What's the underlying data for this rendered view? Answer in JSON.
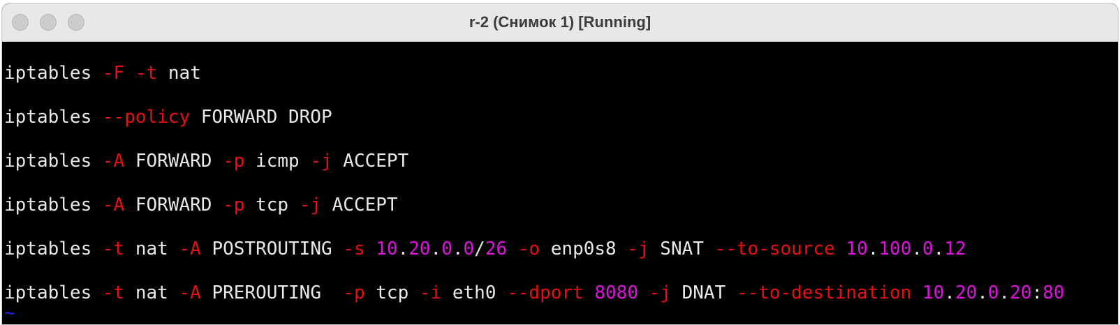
{
  "window": {
    "title": "r-2 (Снимок 1) [Running]"
  },
  "terminal": {
    "lines": [
      {
        "tokens": [
          {
            "text": "iptables ",
            "color": "white"
          },
          {
            "text": "-F -t",
            "color": "red"
          },
          {
            "text": " nat",
            "color": "white"
          }
        ]
      },
      {
        "tokens": [
          {
            "text": "iptables ",
            "color": "white"
          },
          {
            "text": "--policy",
            "color": "red"
          },
          {
            "text": " FORWARD DROP",
            "color": "white"
          }
        ]
      },
      {
        "tokens": [
          {
            "text": "iptables ",
            "color": "white"
          },
          {
            "text": "-A",
            "color": "red"
          },
          {
            "text": " FORWARD ",
            "color": "white"
          },
          {
            "text": "-p",
            "color": "red"
          },
          {
            "text": " icmp ",
            "color": "white"
          },
          {
            "text": "-j",
            "color": "red"
          },
          {
            "text": " ACCEPT",
            "color": "white"
          }
        ]
      },
      {
        "tokens": [
          {
            "text": "iptables ",
            "color": "white"
          },
          {
            "text": "-A",
            "color": "red"
          },
          {
            "text": " FORWARD ",
            "color": "white"
          },
          {
            "text": "-p",
            "color": "red"
          },
          {
            "text": " tcp ",
            "color": "white"
          },
          {
            "text": "-j",
            "color": "red"
          },
          {
            "text": " ACCEPT",
            "color": "white"
          }
        ]
      },
      {
        "tokens": [
          {
            "text": "iptables ",
            "color": "white"
          },
          {
            "text": "-t",
            "color": "red"
          },
          {
            "text": " nat ",
            "color": "white"
          },
          {
            "text": "-A",
            "color": "red"
          },
          {
            "text": " POSTROUTING ",
            "color": "white"
          },
          {
            "text": "-s",
            "color": "red"
          },
          {
            "text": " ",
            "color": "white"
          },
          {
            "text": "10",
            "color": "magenta"
          },
          {
            "text": ".",
            "color": "white"
          },
          {
            "text": "20",
            "color": "magenta"
          },
          {
            "text": ".",
            "color": "white"
          },
          {
            "text": "0",
            "color": "magenta"
          },
          {
            "text": ".",
            "color": "white"
          },
          {
            "text": "0",
            "color": "magenta"
          },
          {
            "text": "/",
            "color": "white"
          },
          {
            "text": "26",
            "color": "magenta"
          },
          {
            "text": " ",
            "color": "white"
          },
          {
            "text": "-o",
            "color": "red"
          },
          {
            "text": " enp0s8 ",
            "color": "white"
          },
          {
            "text": "-j",
            "color": "red"
          },
          {
            "text": " SNAT ",
            "color": "white"
          },
          {
            "text": "--to-source",
            "color": "red"
          },
          {
            "text": " ",
            "color": "white"
          },
          {
            "text": "10",
            "color": "magenta"
          },
          {
            "text": ".",
            "color": "white"
          },
          {
            "text": "100",
            "color": "magenta"
          },
          {
            "text": ".",
            "color": "white"
          },
          {
            "text": "0",
            "color": "magenta"
          },
          {
            "text": ".",
            "color": "white"
          },
          {
            "text": "12",
            "color": "magenta"
          }
        ]
      },
      {
        "tokens": [
          {
            "text": "iptables ",
            "color": "white"
          },
          {
            "text": "-t",
            "color": "red"
          },
          {
            "text": " nat ",
            "color": "white"
          },
          {
            "text": "-A",
            "color": "red"
          },
          {
            "text": " PREROUTING  ",
            "color": "white"
          },
          {
            "text": "-p",
            "color": "red"
          },
          {
            "text": " tcp ",
            "color": "white"
          },
          {
            "text": "-i",
            "color": "red"
          },
          {
            "text": " eth0 ",
            "color": "white"
          },
          {
            "text": "--dport",
            "color": "red"
          },
          {
            "text": " ",
            "color": "white"
          },
          {
            "text": "8080",
            "color": "magenta"
          },
          {
            "text": " ",
            "color": "white"
          },
          {
            "text": "-j",
            "color": "red"
          },
          {
            "text": " DNAT ",
            "color": "white"
          },
          {
            "text": "--to-destination",
            "color": "red"
          },
          {
            "text": " ",
            "color": "white"
          },
          {
            "text": "10",
            "color": "magenta"
          },
          {
            "text": ".",
            "color": "white"
          },
          {
            "text": "20",
            "color": "magenta"
          },
          {
            "text": ".",
            "color": "white"
          },
          {
            "text": "0",
            "color": "magenta"
          },
          {
            "text": ".",
            "color": "white"
          },
          {
            "text": "20",
            "color": "magenta"
          },
          {
            "text": ":",
            "color": "white"
          },
          {
            "text": "80",
            "color": "magenta"
          }
        ]
      }
    ],
    "tilde": "~",
    "colors": {
      "white": "#e8e8e8",
      "red": "#e81010",
      "magenta": "#e010e0",
      "blue": "#2020ff",
      "background": "#000000"
    }
  }
}
